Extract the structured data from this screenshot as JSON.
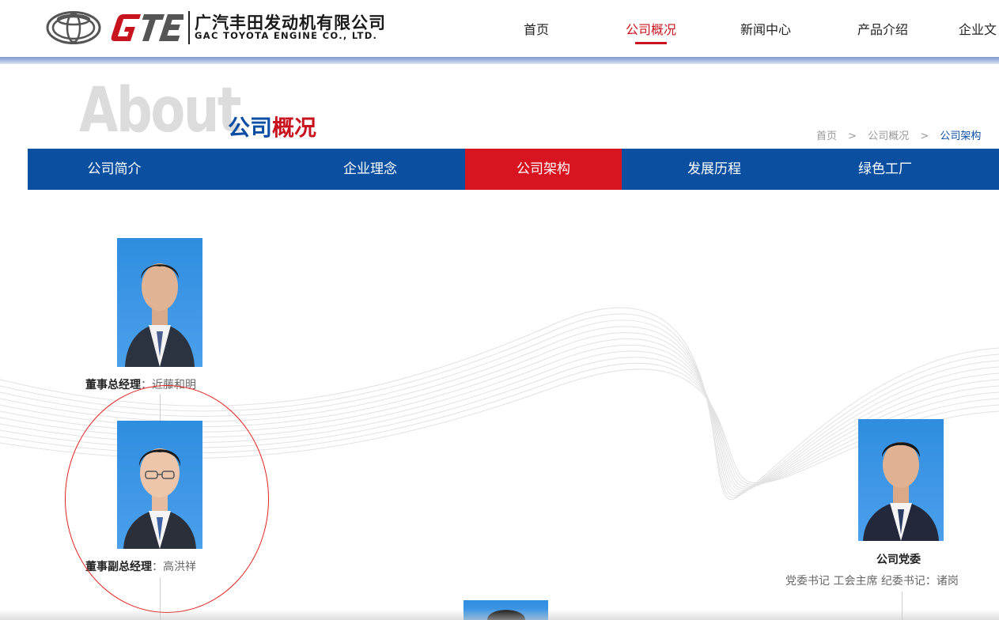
{
  "header": {
    "logo_cn": "广汽丰田发动机有限公司",
    "logo_en": "GAC TOYOTA ENGINE CO., LTD.",
    "nav": [
      "首页",
      "公司概况",
      "新闻中心",
      "产品介绍",
      "企业文"
    ],
    "active_nav": "公司概况"
  },
  "title": {
    "about_word": "About",
    "cn_part1": "公司",
    "cn_part2": "概况"
  },
  "breadcrumb": {
    "items": [
      "首页",
      "公司概况",
      "公司架构"
    ],
    "separator": ">"
  },
  "subnav": {
    "items": [
      "公司简介",
      "企业理念",
      "公司架构",
      "发展历程",
      "绿色工厂"
    ],
    "active": "公司架构"
  },
  "org": {
    "gm": {
      "role": "董事总经理",
      "name": "近藤和明"
    },
    "deputy": {
      "role": "董事副总经理",
      "name": "高洪祥"
    },
    "party": {
      "title": "公司党委",
      "roles": "党委书记  工会主席  纪委书记：诸岗"
    }
  },
  "colors": {
    "brand_blue": "#0b50a0",
    "brand_red": "#d7141f",
    "photo_bg": "#3f97e6"
  }
}
